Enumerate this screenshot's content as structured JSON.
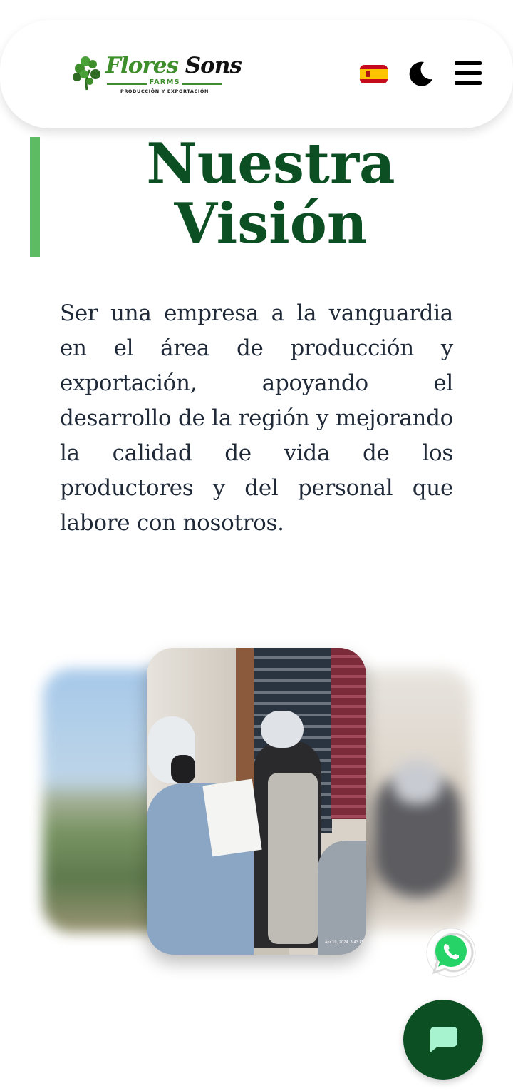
{
  "header": {
    "logo": {
      "brand_primary": "Flores",
      "brand_secondary": "Sons",
      "sub": "FARMS",
      "tagline": "PRODUCCIÓN Y EXPORTACIÓN"
    },
    "language_flag_icon": "spain-flag-icon",
    "theme_icon": "moon-icon",
    "menu_icon": "hamburger-menu-icon"
  },
  "section": {
    "title_line1": "Nuestra",
    "title_line2": "Visión",
    "text": "Ser una empresa a la vanguardia en el área de producción y exportación, apoyando el desarrollo de la región y mejorando la calidad de vida de los productores y del personal que labore con nosotros."
  },
  "carousel": {
    "main_stamp": "Apr 10, 2024, 3:43 PM"
  },
  "floating": {
    "whatsapp_icon": "whatsapp-icon",
    "chat_icon": "chat-bubble-icon"
  },
  "colors": {
    "primary": "#0b4f23",
    "accent": "#5dbb63",
    "brand_green": "#3e8f2c"
  }
}
